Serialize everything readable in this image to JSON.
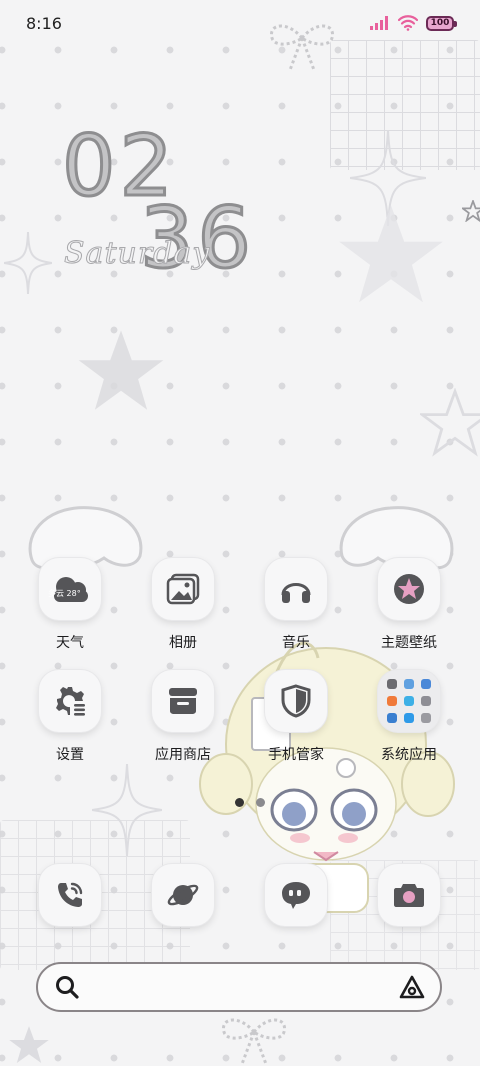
{
  "status_bar": {
    "time": "8:16",
    "battery": "100"
  },
  "clock": {
    "hour": "02",
    "minute": "36",
    "day": "Saturday"
  },
  "weather_widget": {
    "text": "多云 28°"
  },
  "apps": [
    {
      "label": "天气",
      "icon": "weather-cloud-icon"
    },
    {
      "label": "相册",
      "icon": "gallery-icon"
    },
    {
      "label": "音乐",
      "icon": "headphones-icon"
    },
    {
      "label": "主题壁纸",
      "icon": "theme-star-icon"
    },
    {
      "label": "设置",
      "icon": "settings-gear-icon"
    },
    {
      "label": "应用商店",
      "icon": "store-icon"
    },
    {
      "label": "手机管家",
      "icon": "shield-icon"
    },
    {
      "label": "系统应用",
      "icon": "folder-icon"
    }
  ],
  "dock": [
    {
      "name": "phone",
      "icon": "phone-icon"
    },
    {
      "name": "browser",
      "icon": "planet-icon"
    },
    {
      "name": "messages",
      "icon": "message-bubble-icon"
    },
    {
      "name": "camera",
      "icon": "camera-icon"
    }
  ],
  "colors": {
    "icon_gray": "#555558",
    "theme_pink": "#e6a0c2",
    "battery_fill": "#e8a6cf",
    "signal_pink": "#e8609c"
  },
  "pager": {
    "current_page": 1,
    "total_pages": 2
  }
}
